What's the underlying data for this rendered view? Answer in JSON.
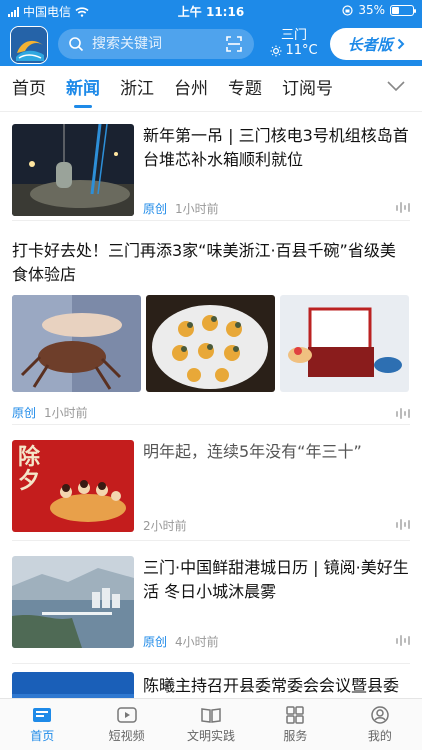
{
  "status": {
    "carrier": "中国电信",
    "time": "上午 11:16",
    "battery": "35%",
    "battery_level": 0.35
  },
  "header": {
    "search_placeholder": "搜索关键词",
    "city": "三门",
    "temperature": "11°C",
    "elder_mode_label": "长者版",
    "logo_icon": "app-logo-icon",
    "colors": {
      "brand": "#1e8ae8",
      "text_dark": "#111111",
      "muted": "#999999"
    }
  },
  "tabs": [
    {
      "label": "首页"
    },
    {
      "label": "新闻"
    },
    {
      "label": "浙江"
    },
    {
      "label": "台州"
    },
    {
      "label": "专题"
    },
    {
      "label": "订阅号"
    }
  ],
  "feed": [
    {
      "title": "新年第一吊 | 三门核电3号机组核岛首台堆芯补水箱顺利就位",
      "source": "原创",
      "time": "1小时前"
    },
    {
      "title": "打卡好去处！三门再添3家“味美浙江·百县千碗”省级美食体验店",
      "source": "原创",
      "time": "1小时前"
    },
    {
      "title": "明年起，连续5年没有“年三十”",
      "time": "2小时前",
      "image_text": "除夕"
    },
    {
      "title": "三门·中国鲜甜港城日历 | 镜阅·美好生活 冬日小城沐晨雾",
      "source": "原创",
      "time": "4小时前"
    },
    {
      "title": "陈曦主持召开县委常委会会议暨县委"
    }
  ],
  "bottom_nav": [
    {
      "label": "首页",
      "icon": "news-home-icon"
    },
    {
      "label": "短视频",
      "icon": "video-play-icon"
    },
    {
      "label": "文明实践",
      "icon": "open-book-icon"
    },
    {
      "label": "服务",
      "icon": "grid-icon"
    },
    {
      "label": "我的",
      "icon": "user-icon"
    }
  ]
}
